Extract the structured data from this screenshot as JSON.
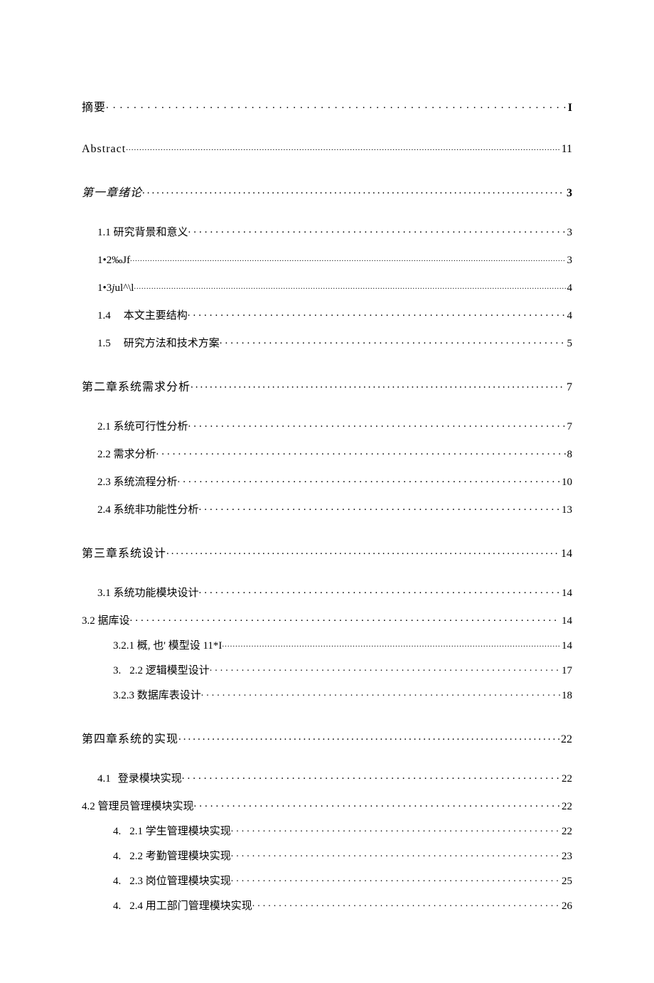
{
  "toc": {
    "abstract_cn": {
      "label": "摘要",
      "page": "I"
    },
    "abstract_en": {
      "label": "Abstract",
      "page": "11"
    },
    "ch1": {
      "label": "第一章绪论",
      "page": "3"
    },
    "s1_1": {
      "label": "1.1 研究背景和意义",
      "page": "3"
    },
    "s1_2": {
      "label": "1•2‰Jf",
      "page": "3"
    },
    "s1_3": {
      "label": "1•3jul^\\l",
      "page": "4"
    },
    "s1_4": {
      "label_num": "1.4",
      "label_text": "本文主要结构",
      "page": "4"
    },
    "s1_5": {
      "label_num": "1.5",
      "label_text": "研究方法和技术方案",
      "page": "5"
    },
    "ch2": {
      "label": "第二章系统需求分析",
      "page": "7"
    },
    "s2_1": {
      "label": "2.1 系统可行性分析",
      "page": "7"
    },
    "s2_2": {
      "label": "2.2 需求分析",
      "page": "8"
    },
    "s2_3": {
      "label": "2.3 系统流程分析",
      "page": "10"
    },
    "s2_4": {
      "label": "2.4 系统非功能性分析",
      "page": "13"
    },
    "ch3": {
      "label": "第三章系统设计",
      "page": "14"
    },
    "s3_1": {
      "label": "3.1 系统功能模块设计",
      "page": "14"
    },
    "s3_2": {
      "label": "3.2 据库设",
      "page": "14"
    },
    "s3_2_1": {
      "label": "3.2.1 概, 也' 模型设 11*I",
      "page": "14"
    },
    "s3_2_2": {
      "label_num": "3.",
      "label_text": "2.2 逻辑模型设计",
      "page": "17"
    },
    "s3_2_3": {
      "label": "3.2.3 数据库表设计",
      "page": "18"
    },
    "ch4": {
      "label": "第四章系统的实现",
      "page": "22"
    },
    "s4_1": {
      "label_num": "4.1",
      "label_text": "登录模块实现",
      "page": "22"
    },
    "s4_2": {
      "label": "4.2 管理员管理模块实现",
      "page": "22"
    },
    "s4_2_1": {
      "label_num": "4.",
      "label_text": "2.1 学生管理模块实现",
      "page": "22"
    },
    "s4_2_2": {
      "label_num": "4.",
      "label_text": "2.2 考勤管理模块实现",
      "page": "23"
    },
    "s4_2_3": {
      "label_num": "4.",
      "label_text": "2.3 岗位管理模块实现",
      "page": "25"
    },
    "s4_2_4": {
      "label_num": "4.",
      "label_text": "2.4 用工部门管理模块实现",
      "page": "26"
    }
  }
}
